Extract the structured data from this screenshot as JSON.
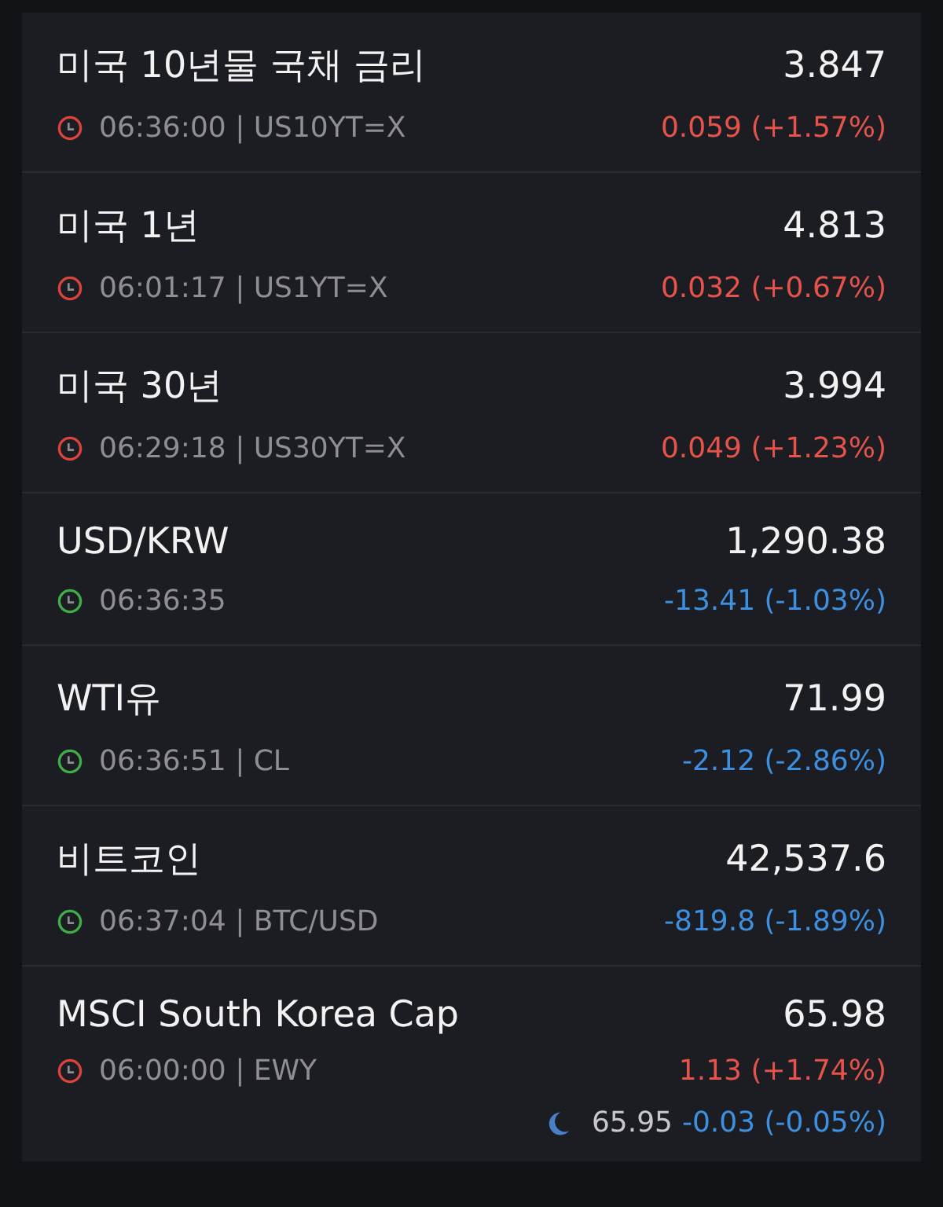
{
  "quotes": [
    {
      "name": "미국 10년물 국채 금리",
      "price": "3.847",
      "market_open": false,
      "info": "06:36:00 | US10YT=X",
      "change": "0.059 (+1.57%)",
      "color": "#e5534b"
    },
    {
      "name": "미국 1년",
      "price": "4.813",
      "market_open": false,
      "info": "06:01:17 | US1YT=X",
      "change": "0.032 (+0.67%)",
      "color": "#e5534b"
    },
    {
      "name": "미국 30년",
      "price": "3.994",
      "market_open": false,
      "info": "06:29:18 | US30YT=X",
      "change": "0.049 (+1.23%)",
      "color": "#e5534b"
    },
    {
      "name": "USD/KRW",
      "price": "1,290.38",
      "market_open": true,
      "info": "06:36:35",
      "change": "-13.41 (-1.03%)",
      "color": "#3d8fe0"
    },
    {
      "name": "WTI유",
      "price": "71.99",
      "market_open": true,
      "info": "06:36:51 | CL",
      "change": "-2.12 (-2.86%)",
      "color": "#3d8fe0"
    },
    {
      "name": "비트코인",
      "price": "42,537.6",
      "market_open": true,
      "info": "06:37:04 | BTC/USD",
      "change": "-819.8 (-1.89%)",
      "color": "#3d8fe0"
    },
    {
      "name": "MSCI South Korea Cap",
      "price": "65.98",
      "market_open": false,
      "info": "06:00:00 | EWY",
      "change": "1.13 (+1.74%)",
      "color": "#e5534b",
      "after_hours": {
        "price": "65.95",
        "change": "-0.03 (-0.05%)",
        "color": "#3d8fe0"
      }
    }
  ]
}
